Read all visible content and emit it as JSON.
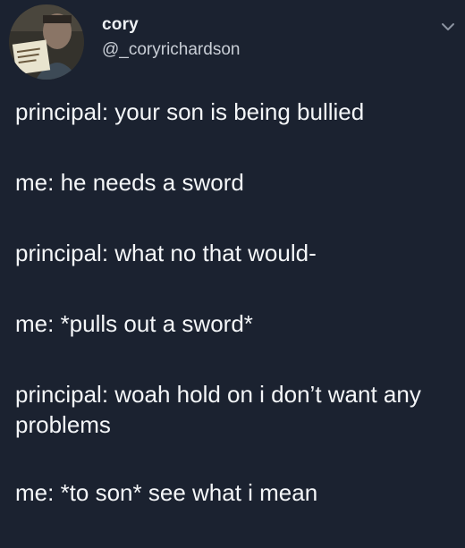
{
  "tweet": {
    "author": {
      "display_name": "cory",
      "handle": "@_coryrichardson"
    },
    "lines": [
      "principal: your son is being bullied",
      "me: he needs a sword",
      "principal: what no that would-",
      "me: *pulls out a sword*",
      "principal: woah hold on i don’t want any problems",
      "me: *to son* see what i mean"
    ]
  },
  "icons": {
    "chevron": "chevron-down-icon"
  },
  "colors": {
    "background": "#1b2230",
    "text": "#f4f6f8",
    "secondary_text": "#c9ced6"
  }
}
